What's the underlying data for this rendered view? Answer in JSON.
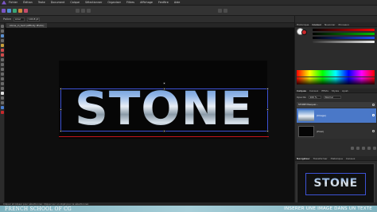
{
  "menubar": {
    "items": [
      "Fichier",
      "Édition",
      "Texte",
      "Document",
      "Calque",
      "Sélectionner",
      "Organiser",
      "Filtres",
      "Affichage",
      "Fenêtre",
      "Aide"
    ]
  },
  "context": {
    "font_label": "Police",
    "font_value": "Arial",
    "size_value": "100,8 pt"
  },
  "document": {
    "tab_label": "stone_in_text (Affinity Photo)"
  },
  "right_panel": {
    "color_tabs": [
      "Historique",
      "Couleur",
      "Nuancier",
      "Pinceaux"
    ],
    "layers_tabs": [
      "Calques",
      "Canaux",
      "Effets",
      "Styles",
      "Ajust."
    ],
    "opacity_label": "Opacité",
    "opacity_value": "100 %",
    "blend_mode": "Normal",
    "text_layer_name": "STONE Masquer...",
    "image_layer_type": "(Image)",
    "bg_layer_type": "(Pixel)",
    "nav_tabs": [
      "Navigateur",
      "Transformer",
      "Historique",
      "Canaux"
    ],
    "nav_preview_text": "STONE"
  },
  "canvas": {
    "stone_text": "STONE"
  },
  "statusbar": {
    "text": "Cliquer et Glisser pour sélectionner. Cliquer sur un objet pour le sélectionner."
  },
  "footer": {
    "brand": "FRENCH SCHOOL OF CG",
    "title": "INSERER UNE IMAGE DANS UN TEXTE"
  },
  "colors": {
    "selection": "#3d52d4",
    "baseline": "#c4151b",
    "banner": "#a6ced8",
    "stroke_well": "#c8282b",
    "fill_well": "#f4f4f4"
  }
}
